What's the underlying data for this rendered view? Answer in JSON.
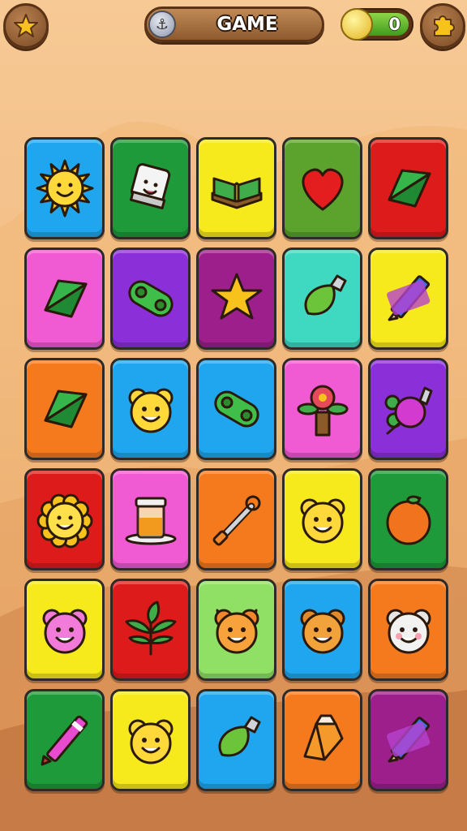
{
  "header": {
    "title": "GAME",
    "coin_count": "0",
    "left_button_icon": "star-icon",
    "right_button_icon": "puzzle-icon",
    "title_icon": "anchor-icon",
    "coin_icon": "coin-icon"
  },
  "colors": {
    "blue": "#1fa6ee",
    "green": "#1e9a3a",
    "yellow": "#f7ea1c",
    "lime": "#5ba32c",
    "red": "#de1b1b",
    "pink": "#f05ad2",
    "purple": "#8b2fd8",
    "magenta": "#9c1f8c",
    "teal": "#3fd8c0",
    "orange": "#f57a1e",
    "lightgreen": "#8fe065"
  },
  "cards": [
    {
      "color": "blue",
      "icon": "sun-icon"
    },
    {
      "color": "green",
      "icon": "dice-icon"
    },
    {
      "color": "yellow",
      "icon": "book-icon"
    },
    {
      "color": "lime",
      "icon": "heart-icon"
    },
    {
      "color": "red",
      "icon": "kite-icon"
    },
    {
      "color": "pink",
      "icon": "kite-icon"
    },
    {
      "color": "purple",
      "icon": "gamepad-icon"
    },
    {
      "color": "magenta",
      "icon": "star-icon"
    },
    {
      "color": "teal",
      "icon": "leaf-drop-icon"
    },
    {
      "color": "yellow",
      "icon": "pencil-icon"
    },
    {
      "color": "orange",
      "icon": "kite-icon"
    },
    {
      "color": "blue",
      "icon": "bear-face-icon"
    },
    {
      "color": "blue",
      "icon": "gamepad-icon"
    },
    {
      "color": "pink",
      "icon": "flower-pot-icon"
    },
    {
      "color": "purple",
      "icon": "turtle-icon"
    },
    {
      "color": "red",
      "icon": "lion-face-icon"
    },
    {
      "color": "pink",
      "icon": "honey-jar-icon"
    },
    {
      "color": "orange",
      "icon": "scissors-icon"
    },
    {
      "color": "yellow",
      "icon": "bear-face-icon"
    },
    {
      "color": "green",
      "icon": "orange-fruit-icon"
    },
    {
      "color": "yellow",
      "icon": "pink-bear-icon"
    },
    {
      "color": "red",
      "icon": "leaves-icon"
    },
    {
      "color": "lightgreen",
      "icon": "fox-face-icon"
    },
    {
      "color": "blue",
      "icon": "brown-bear-icon"
    },
    {
      "color": "orange",
      "icon": "white-bear-icon"
    },
    {
      "color": "green",
      "icon": "crayon-icon"
    },
    {
      "color": "yellow",
      "icon": "bear-face-icon"
    },
    {
      "color": "blue",
      "icon": "leaf-drop-icon"
    },
    {
      "color": "orange",
      "icon": "gem-icon"
    },
    {
      "color": "magenta",
      "icon": "pencil-icon"
    }
  ]
}
